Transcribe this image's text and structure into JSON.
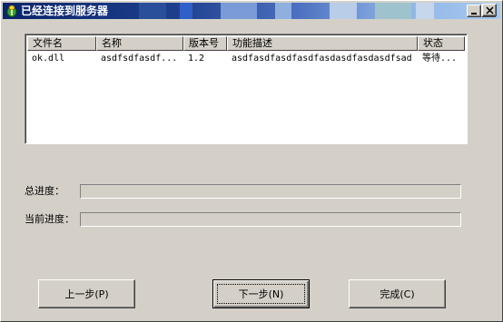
{
  "window": {
    "title": "已经连接到服务器"
  },
  "list": {
    "columns": [
      "文件名",
      "名称",
      "版本号",
      "功能描述",
      "状态"
    ],
    "rows": [
      [
        "ok.dll",
        "asdfsdfasdf...",
        "1.2",
        "asdfasdfasdfasdfasdasdfasdasdfsad",
        "等待..."
      ]
    ]
  },
  "progress": {
    "total_label": "总进度：",
    "total_value": 0,
    "current_label": "当前进度：",
    "current_value": 0
  },
  "buttons": {
    "prev_label": "上一步(P)",
    "next_label": "下一步(N)",
    "finish_label": "完成(C)"
  },
  "colors": {
    "title_start": "#0a246a",
    "title_end": "#a6caf0",
    "face": "#d4d0c8"
  },
  "icons": {
    "app": "app-icon",
    "minimize": "minimize-icon",
    "maximize": "maximize-icon",
    "close": "close-icon"
  }
}
